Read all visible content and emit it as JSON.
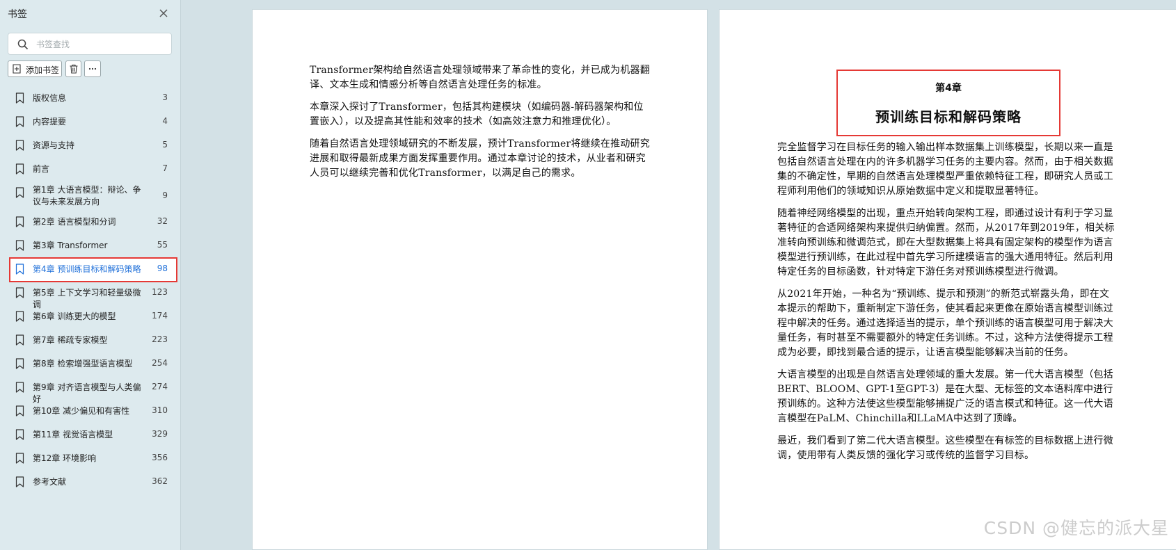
{
  "sidebar": {
    "title": "书签",
    "search_placeholder": "书签查找",
    "add_label": "添加书签",
    "items": [
      {
        "title": "版权信息",
        "page": "3"
      },
      {
        "title": "内容提要",
        "page": "4"
      },
      {
        "title": "资源与支持",
        "page": "5"
      },
      {
        "title": "前言",
        "page": "7"
      },
      {
        "title": "第1章 大语言模型：辩论、争议与未来发展方向",
        "page": "9"
      },
      {
        "title": "第2章 语言模型和分词",
        "page": "32"
      },
      {
        "title": "第3章 Transformer",
        "page": "55"
      },
      {
        "title": "第4章 预训练目标和解码策略",
        "page": "98"
      },
      {
        "title": "第5章 上下文学习和轻量级微调",
        "page": "123"
      },
      {
        "title": "第6章 训练更大的模型",
        "page": "174"
      },
      {
        "title": "第7章 稀疏专家模型",
        "page": "223"
      },
      {
        "title": "第8章 检索增强型语言模型",
        "page": "254"
      },
      {
        "title": "第9章 对齐语言模型与人类偏好",
        "page": "274"
      },
      {
        "title": "第10章 减少偏见和有害性",
        "page": "310"
      },
      {
        "title": "第11章 视觉语言模型",
        "page": "329"
      },
      {
        "title": "第12章 环境影响",
        "page": "356"
      },
      {
        "title": "参考文献",
        "page": "362"
      }
    ]
  },
  "left_page": {
    "paragraphs": [
      "Transformer架构给自然语言处理领域带来了革命性的变化，并已成为机器翻译、文本生成和情感分析等自然语言处理任务的标准。",
      "本章深入探讨了Transformer，包括其构建模块（如编码器-解码器架构和位置嵌入），以及提高其性能和效率的技术（如高效注意力和推理优化）。",
      "随着自然语言处理领域研究的不断发展，预计Transformer将继续在推动研究进展和取得最新成果方面发挥重要作用。通过本章讨论的技术，从业者和研究人员可以继续完善和优化Transformer，以满足自己的需求。"
    ]
  },
  "right_page": {
    "chapter_no": "第4章",
    "chapter_title": "预训练目标和解码策略",
    "paragraphs": [
      "完全监督学习在目标任务的输入输出样本数据集上训练模型，长期以来一直是包括自然语言处理在内的许多机器学习任务的主要内容。然而，由于相关数据集的不确定性，早期的自然语言处理模型严重依赖特征工程，即研究人员或工程师利用他们的领域知识从原始数据中定义和提取显著特征。",
      "随着神经网络模型的出现，重点开始转向架构工程，即通过设计有利于学习显著特征的合适网络架构来提供归纳偏置。然而，从2017年到2019年，相关标准转向预训练和微调范式，即在大型数据集上将具有固定架构的模型作为语言模型进行预训练，在此过程中首先学习所建模语言的强大通用特征。然后利用特定任务的目标函数，针对特定下游任务对预训练模型进行微调。",
      "从2021年开始，一种名为“预训练、提示和预测”的新范式崭露头角，即在文本提示的帮助下，重新制定下游任务，使其看起来更像在原始语言模型训练过程中解决的任务。通过选择适当的提示，单个预训练的语言模型可用于解决大量任务，有时甚至不需要额外的特定任务训练。不过，这种方法使得提示工程成为必要，即找到最合适的提示，让语言模型能够解决当前的任务。",
      "大语言模型的出现是自然语言处理领域的重大发展。第一代大语言模型（包括BERT、BLOOM、GPT-1至GPT-3）是在大型、无标签的文本语料库中进行预训练的。这种方法使这些模型能够捕捉广泛的语言模式和特征。这一代大语言模型在PaLM、Chinchilla和LLaMA中达到了顶峰。",
      "最近，我们看到了第二代大语言模型。这些模型在有标签的目标数据上进行微调，使用带有人类反馈的强化学习或传统的监督学习目标。"
    ]
  },
  "watermark": "CSDN @健忘的派大星",
  "colors": {
    "accent": "#1e6fd9",
    "highlight_border": "#e53935",
    "sidebar_bg": "#ddeaee",
    "workspace_bg": "#d3e1e6"
  },
  "icons": {
    "close": "close-icon",
    "search": "search-icon",
    "add": "add-bookmark-icon",
    "delete": "trash-icon",
    "more": "more-icon",
    "bookmark": "bookmark-icon"
  }
}
